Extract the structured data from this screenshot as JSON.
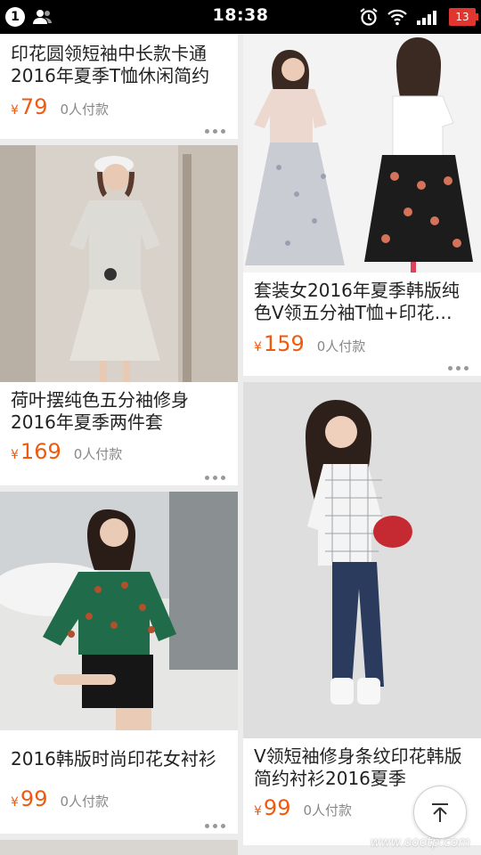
{
  "status_bar": {
    "time": "18:38",
    "notification_count": "1",
    "battery_level": "13"
  },
  "products": [
    {
      "title": "印花圆领短袖中长款卡通2016年夏季T恤休闲简约",
      "currency": "¥",
      "price": "79",
      "buyers": "0人付款"
    },
    {
      "title": "荷叶摆纯色五分袖修身2016年夏季两件套",
      "currency": "¥",
      "price": "169",
      "buyers": "0人付款"
    },
    {
      "title": "2016韩版时尚印花女衬衫",
      "currency": "¥",
      "price": "99",
      "buyers": "0人付款"
    },
    {
      "title": "套装女2016年夏季韩版纯色V领五分袖T恤+印花…",
      "currency": "¥",
      "price": "159",
      "buyers": "0人付款"
    },
    {
      "title": "V领短袖修身条纹印花韩版简约衬衫2016夏季",
      "currency": "¥",
      "price": "99",
      "buyers": "0人付款"
    }
  ],
  "back_to_top_icon": "arrow-up-to-line-icon",
  "watermark": "www.oootp.com",
  "colors": {
    "price": "#f05a0f",
    "background": "#ececec",
    "battery": "#e0362f"
  }
}
